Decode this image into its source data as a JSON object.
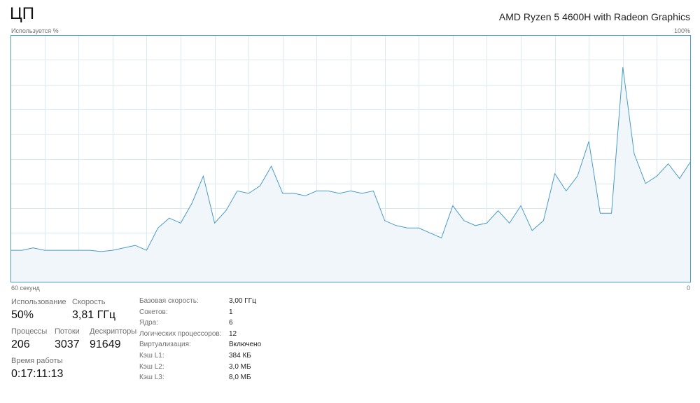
{
  "header": {
    "title": "ЦП",
    "model": "AMD Ryzen 5 4600H with Radeon Graphics"
  },
  "graph": {
    "usage_label": "Используется %",
    "max_label": "100%",
    "time_label": "60 секунд",
    "zero_label": "0",
    "line_color": "#4a9bc8",
    "fill_color": "#f1f6fb",
    "grid_color": "#d9eaf4"
  },
  "chart_data": {
    "type": "area",
    "ylim": [
      0,
      100
    ],
    "xlim": [
      60,
      0
    ],
    "grid": true,
    "x": [
      60,
      59,
      58,
      57,
      56,
      55,
      54,
      53,
      52,
      51,
      50,
      49,
      48,
      47,
      46,
      45,
      44,
      43,
      42,
      41,
      40,
      39,
      38,
      37,
      36,
      35,
      34,
      33,
      32,
      31,
      30,
      29,
      28,
      27,
      26,
      25,
      24,
      23,
      22,
      21,
      20,
      19,
      18,
      17,
      16,
      15,
      14,
      13,
      12,
      11,
      10,
      9,
      8,
      7,
      6,
      5,
      4,
      3,
      2,
      1,
      0
    ],
    "values": [
      13,
      13,
      14,
      13,
      13,
      13,
      13,
      13,
      12.5,
      13,
      14,
      15,
      13,
      22,
      26,
      24,
      32,
      43,
      24,
      29,
      37,
      36,
      39,
      47,
      36,
      36,
      35,
      37,
      37,
      36,
      37,
      36,
      37,
      25,
      23,
      22,
      22,
      20,
      18,
      31,
      25,
      23,
      24,
      29,
      24,
      31,
      21,
      25,
      44,
      37,
      43,
      57,
      28,
      28,
      87,
      52,
      40,
      43,
      48,
      42,
      49
    ]
  },
  "stats": {
    "usage": {
      "label": "Использование",
      "value": "50%"
    },
    "speed": {
      "label": "Скорость",
      "value": "3,81 ГГц"
    },
    "processes": {
      "label": "Процессы",
      "value": "206"
    },
    "threads": {
      "label": "Потоки",
      "value": "3037"
    },
    "handles": {
      "label": "Дескрипторы",
      "value": "91649"
    },
    "uptime": {
      "label": "Время работы",
      "value": "0:17:11:13"
    }
  },
  "specs": [
    {
      "key": "Базовая скорость:",
      "value": "3,00 ГГц"
    },
    {
      "key": "Сокетов:",
      "value": "1"
    },
    {
      "key": "Ядра:",
      "value": "6"
    },
    {
      "key": "Логических процессоров:",
      "value": "12"
    },
    {
      "key": "Виртуализация:",
      "value": "Включено"
    },
    {
      "key": "Кэш L1:",
      "value": "384 КБ"
    },
    {
      "key": "Кэш L2:",
      "value": "3,0 МБ"
    },
    {
      "key": "Кэш L3:",
      "value": "8,0 МБ"
    }
  ]
}
